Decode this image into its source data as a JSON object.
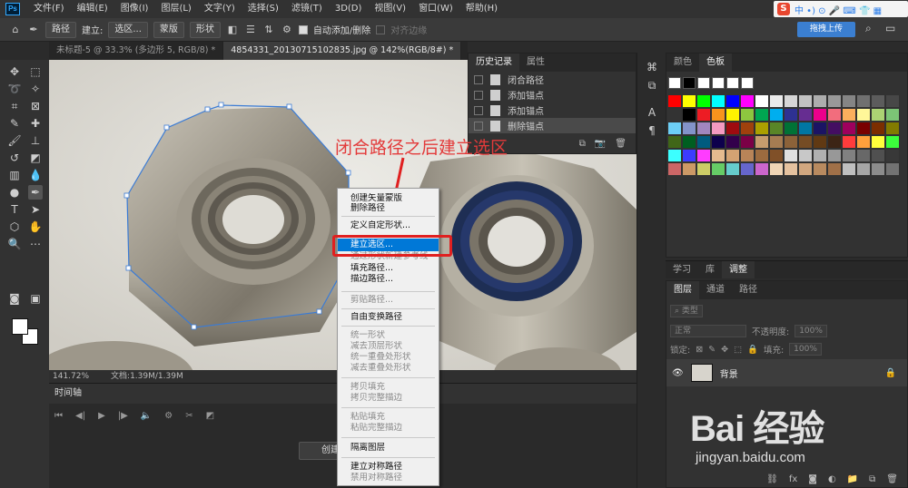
{
  "app": {
    "logo": "Ps"
  },
  "menubar": [
    "文件(F)",
    "编辑(E)",
    "图像(I)",
    "图层(L)",
    "文字(Y)",
    "选择(S)",
    "滤镜(T)",
    "3D(D)",
    "视图(V)",
    "窗口(W)",
    "帮助(H)"
  ],
  "ime": {
    "label": "中 •) ⊙ 🎤 ⌨ 👕 ▦"
  },
  "options": {
    "mode": "路径",
    "make_label": "建立:",
    "selection": "选区...",
    "mask": "蒙版",
    "shape": "形状",
    "auto_add": "自动添加/删除",
    "align_edges": "对齐边缘",
    "upload": "拖拽上传"
  },
  "tabs": [
    {
      "label": "未标题-5 @ 33.3% (多边形 5, RGB/8) *"
    },
    {
      "label": "4854331_20130715102835.jpg @ 142%(RGB/8#) *"
    }
  ],
  "status": {
    "zoom": "141.72%",
    "doc": "文档:1.39M/1.39M"
  },
  "timeline": {
    "title": "时间轴",
    "create_video": "创建视频"
  },
  "history": {
    "tabs": [
      "历史记录",
      "属性"
    ],
    "items": [
      "闭合路径",
      "添加锚点",
      "添加锚点",
      "删除锚点"
    ]
  },
  "swatches": {
    "tabs": [
      "颜色",
      "色板"
    ],
    "top_colors": [
      "#ffffff",
      "#000000",
      "#ffffff",
      "#ffffff",
      "#ffffff",
      "#ffffff"
    ],
    "grid": [
      "#ff0000",
      "#ffff00",
      "#00ff00",
      "#00ffff",
      "#0000ff",
      "#ff00ff",
      "#ffffff",
      "#ebebeb",
      "#d6d6d6",
      "#c2c2c2",
      "#adadad",
      "#999999",
      "#858585",
      "#707070",
      "#5c5c5c",
      "#474747",
      "#333333",
      "#000000",
      "#ed1c24",
      "#f7941d",
      "#fff200",
      "#8dc63f",
      "#00a651",
      "#00aeef",
      "#2e3192",
      "#662d91",
      "#ec008c",
      "#f26d7d",
      "#fbaf5d",
      "#fff799",
      "#acd373",
      "#7cc576",
      "#6dcff6",
      "#8393ca",
      "#a186be",
      "#f49ac1",
      "#9e0b0f",
      "#a0410d",
      "#aba000",
      "#598527",
      "#007236",
      "#0076a3",
      "#1b1464",
      "#440e62",
      "#9e005d",
      "#790000",
      "#7b2e00",
      "#827b00",
      "#406618",
      "#005e20",
      "#005b7f",
      "#0d004c",
      "#32004b",
      "#7b0046",
      "#c69c6d",
      "#a67c52",
      "#8c6239",
      "#754c24",
      "#603913",
      "#3c2415",
      "#ff3c3c",
      "#ffa03c",
      "#ffff3c",
      "#3cff3c",
      "#3cffff",
      "#3c3cff",
      "#ff3cff",
      "#e6bb8f",
      "#d4a373",
      "#b88458",
      "#9c6b3f",
      "#805028",
      "#e0e0e0",
      "#c8c8c8",
      "#b0b0b0",
      "#989898",
      "#808080",
      "#686868",
      "#505050",
      "#383838",
      "#cc6666",
      "#cc9966",
      "#cccc66",
      "#66cc66",
      "#66cccc",
      "#6666cc",
      "#cc66cc",
      "#f0d5b5",
      "#e5c29f",
      "#d1a77f",
      "#b88a5f",
      "#a07048",
      "#bfbfbf",
      "#a6a6a6",
      "#8c8c8c",
      "#737373"
    ]
  },
  "adjust_tabs": [
    "学习",
    "库",
    "调整"
  ],
  "layers": {
    "tabs": [
      "图层",
      "通道",
      "路径"
    ],
    "kind": "类型",
    "blend": "正常",
    "opacity_label": "不透明度:",
    "opacity": "100%",
    "lock_label": "锁定:",
    "fill_label": "填充:",
    "fill": "100%",
    "layer_name": "背景"
  },
  "context_menu": {
    "items": [
      {
        "label": "创建矢量蒙版",
        "enabled": true
      },
      {
        "label": "删除路径",
        "enabled": true
      },
      {
        "label": "定义自定形状...",
        "enabled": true
      },
      {
        "label": "建立选区...",
        "enabled": true,
        "highlighted": true
      },
      {
        "label": "通过形状新建参考线",
        "enabled": false
      },
      {
        "label": "填充路径...",
        "enabled": true
      },
      {
        "label": "描边路径...",
        "enabled": true
      },
      {
        "label": "剪贴路径...",
        "enabled": false
      },
      {
        "label": "自由变换路径",
        "enabled": true
      },
      {
        "label": "统一形状",
        "enabled": false
      },
      {
        "label": "减去顶层形状",
        "enabled": false
      },
      {
        "label": "统一重叠处形状",
        "enabled": false
      },
      {
        "label": "减去重叠处形状",
        "enabled": false
      },
      {
        "label": "拷贝填充",
        "enabled": false
      },
      {
        "label": "拷贝完整描边",
        "enabled": false
      },
      {
        "label": "粘贴填充",
        "enabled": false
      },
      {
        "label": "粘贴完整描边",
        "enabled": false
      },
      {
        "label": "隔离图层",
        "enabled": true
      },
      {
        "label": "建立对称路径",
        "enabled": true
      },
      {
        "label": "禁用对称路径",
        "enabled": false
      }
    ]
  },
  "annotation": {
    "text": "闭合路径之后建立选区",
    "color": "#e33a3a"
  },
  "watermark": {
    "main": "Bai 经验",
    "sub": "jingyan.baidu.com"
  },
  "colors": {
    "highlight": "#0078d7",
    "annotation_red": "#e02020",
    "path_blue": "#3a7bd5"
  }
}
